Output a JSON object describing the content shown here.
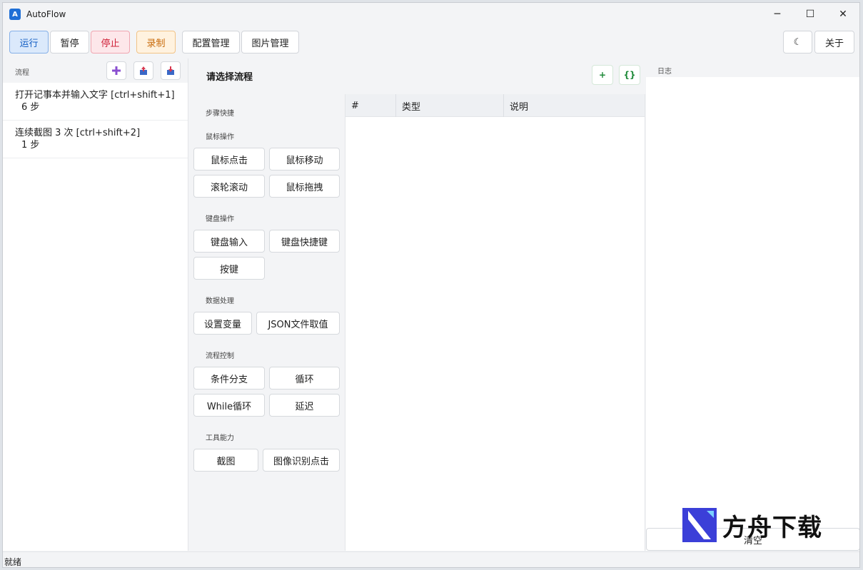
{
  "app": {
    "title": "AutoFlow",
    "logo_text": "A"
  },
  "window_controls": {
    "minimize": "─",
    "maximize": "☐",
    "close": "✕"
  },
  "toolbar": {
    "run": "运行",
    "pause": "暂停",
    "stop": "停止",
    "record": "录制",
    "config": "配置管理",
    "images": "图片管理",
    "theme_icon": "☾",
    "about": "关于"
  },
  "sidebar": {
    "label": "流程",
    "actions": [
      "add-icon",
      "import-icon",
      "export-icon"
    ],
    "items": [
      {
        "name": "打开记事本并输入文字 [ctrl+shift+1]",
        "steps": "6 步"
      },
      {
        "name": "连续截图 3 次 [ctrl+shift+2]",
        "steps": "1 步"
      }
    ]
  },
  "editor": {
    "title": "请选择流程",
    "add_label": "+",
    "json_label": "{}",
    "columns": [
      "#",
      "类型",
      "说明"
    ]
  },
  "steps_panel": {
    "title": "步骤快捷",
    "sections": [
      {
        "label": "鼠标操作",
        "buttons": [
          "鼠标点击",
          "鼠标移动",
          "滚轮滚动",
          "鼠标拖拽"
        ]
      },
      {
        "label": "键盘操作",
        "buttons": [
          "键盘输入",
          "键盘快捷键",
          "按键"
        ]
      },
      {
        "label": "数据处理",
        "buttons": [
          "设置变量",
          "JSON文件取值"
        ]
      },
      {
        "label": "流程控制",
        "buttons": [
          "条件分支",
          "循环",
          "While循环",
          "延迟"
        ]
      },
      {
        "label": "工具能力",
        "buttons": [
          "截图",
          "图像识别点击"
        ]
      }
    ]
  },
  "log": {
    "label": "日志",
    "clear": "清空"
  },
  "status": {
    "text": "就绪"
  },
  "watermark": {
    "text": "方舟下载"
  },
  "colors": {
    "accent": "#1560c4",
    "stop": "#d0243b",
    "record": "#c86a0a",
    "ok": "#1f8a3a"
  }
}
